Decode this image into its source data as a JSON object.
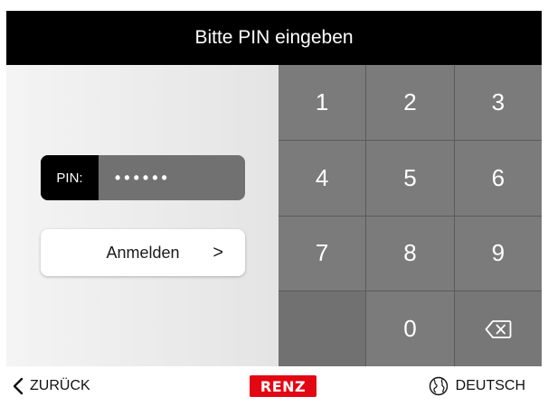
{
  "header": {
    "title": "Bitte PIN eingeben"
  },
  "pin": {
    "label": "PIN:",
    "masked_value": "••••••"
  },
  "login": {
    "label": "Anmelden",
    "chevron": ">"
  },
  "keypad": {
    "keys": [
      "1",
      "2",
      "3",
      "4",
      "5",
      "6",
      "7",
      "8",
      "9",
      "",
      "0",
      "backspace"
    ]
  },
  "footer": {
    "back_label": "ZURÜCK",
    "logo_text": "RENZ",
    "language_label": "DEUTSCH"
  },
  "colors": {
    "header_bg": "#000000",
    "keypad_key": "#7b7b7b",
    "brand_red": "#e30613"
  }
}
